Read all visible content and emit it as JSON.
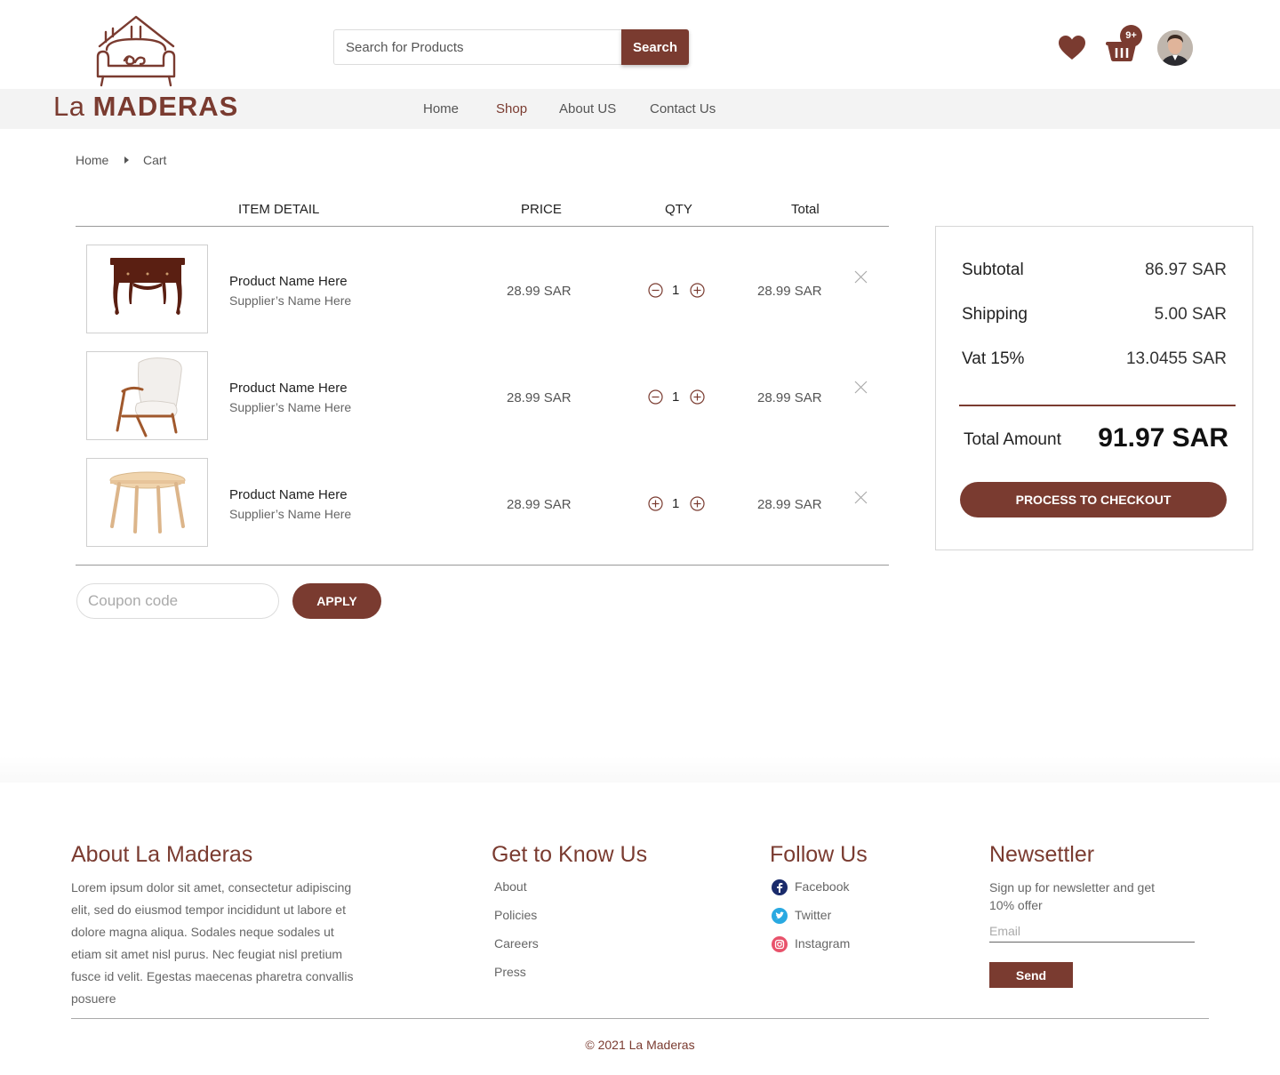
{
  "brand": {
    "name_prefix": "La",
    "name_main": "MADERAS",
    "color": "#7a3b30"
  },
  "search": {
    "placeholder": "Search for Products",
    "button": "Search"
  },
  "header": {
    "cart_badge": "9+"
  },
  "nav": {
    "items": [
      "Home",
      "Shop",
      "About US",
      "Contact Us"
    ],
    "active": "Shop"
  },
  "breadcrumb": [
    "Home",
    "Cart"
  ],
  "table": {
    "headers": {
      "item": "ITEM DETAIL",
      "price": "PRICE",
      "qty": "QTY",
      "total": "Total"
    },
    "rows": [
      {
        "name": "Product Name Here",
        "supplier": "Supplier’s Name Here",
        "price": "28.99 SAR",
        "qty": "1",
        "total": "28.99 SAR",
        "image": "desk"
      },
      {
        "name": "Product Name Here",
        "supplier": "Supplier’s Name Here",
        "price": "28.99 SAR",
        "qty": "1",
        "total": "28.99 SAR",
        "image": "armchair"
      },
      {
        "name": "Product Name Here",
        "supplier": "Supplier’s Name Here",
        "price": "28.99 SAR",
        "qty": "1",
        "total": "28.99 SAR",
        "image": "round-table"
      }
    ]
  },
  "coupon": {
    "placeholder": "Coupon code",
    "button": "APPLY"
  },
  "summary": {
    "subtotal_label": "Subtotal",
    "subtotal": "86.97 SAR",
    "shipping_label": "Shipping",
    "shipping": "5.00 SAR",
    "vat_label": "Vat 15%",
    "vat": "13.0455 SAR",
    "total_label": "Total Amount",
    "total": "91.97 SAR",
    "checkout": "PROCESS TO CHECKOUT"
  },
  "footer": {
    "about": {
      "title": "About La Maderas",
      "text": "Lorem ipsum dolor sit amet, consectetur adipiscing elit, sed do eiusmod tempor incididunt ut labore et dolore magna aliqua. Sodales neque sodales ut etiam sit amet nisl purus. Nec feugiat nisl pretium fusce id velit. Egestas maecenas pharetra convallis posuere"
    },
    "know": {
      "title": "Get to Know Us",
      "links": [
        "About",
        "Policies",
        "Careers",
        "Press"
      ]
    },
    "follow": {
      "title": "Follow Us",
      "links": [
        "Facebook",
        "Twitter",
        "Instagram"
      ]
    },
    "newsletter": {
      "title": "Newsettler",
      "text": "Sign up for newsletter and get 10% offer",
      "placeholder": "Email",
      "button": "Send"
    },
    "copyright": "© 2021 La Maderas"
  }
}
